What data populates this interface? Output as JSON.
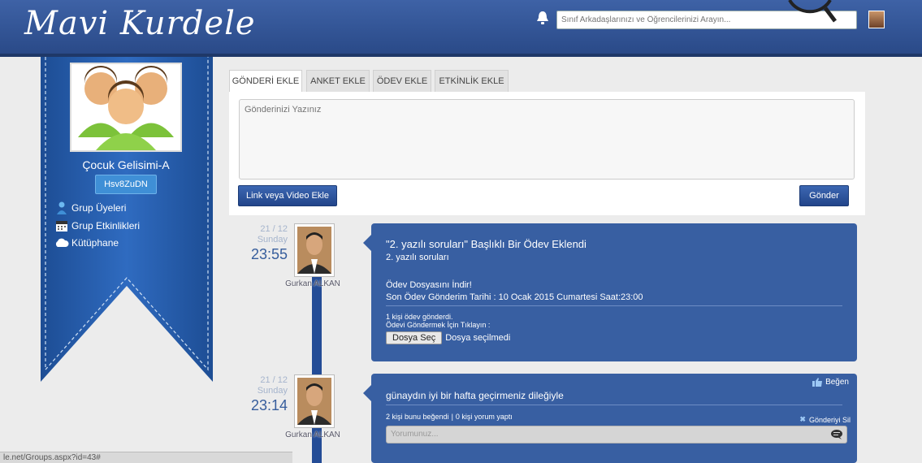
{
  "header": {
    "logo": "Mavi Kurdele",
    "search_placeholder": "Sınıf Arkadaşlarınızı ve Öğrencilerinizi Arayın..."
  },
  "group": {
    "name": "Çocuk Gelisimi-A",
    "code": "Hsv8ZuDN",
    "nav": [
      {
        "label": "Grup Üyeleri",
        "icon": "group-members-icon"
      },
      {
        "label": "Grup Etkinlikleri",
        "icon": "calendar-icon"
      },
      {
        "label": "Kütüphane",
        "icon": "cloud-icon"
      }
    ]
  },
  "composer": {
    "tabs": [
      "GÖNDERİ EKLE",
      "ANKET EKLE",
      "ÖDEV EKLE",
      "ETKİNLİK EKLE"
    ],
    "active_tab": 0,
    "placeholder": "Gönderinizi Yazınız",
    "link_button": "Link veya Video Ekle",
    "send_button": "Gönder"
  },
  "posts": [
    {
      "date": "21 / 12",
      "day": "Sunday",
      "time": "23:55",
      "author": "Gurkan ALKAN",
      "title": "\"2. yazılı soruları\" Başlıklı Bir Ödev Eklendi",
      "subtitle": "2. yazılı soruları",
      "download": "Ödev Dosyasını İndir!",
      "deadline": "Son Ödev Gönderim Tarihi : 10 Ocak 2015 Cumartesi Saat:23:00",
      "submitted": "1 kişi ödev gönderdi.",
      "click_hint": "Ödevi Göndermek İçin Tıklayın :",
      "file_button": "Dosya Seç",
      "file_status": "Dosya seçilmedi"
    },
    {
      "date": "21 / 12",
      "day": "Sunday",
      "time": "23:14",
      "author": "Gurkan ALKAN",
      "like": "Beğen",
      "text": "günaydın iyi bir hafta geçirmeniz dileğiyle",
      "stats_likes": "2 kişi bunu beğendi",
      "stats_sep": "|",
      "stats_comments": "0 kişi yorum yaptı",
      "delete": "Gönderiyi Sil",
      "comment_placeholder": "Yorumunuz..."
    }
  ],
  "status_bar": "le.net/Groups.aspx?id=43#"
}
